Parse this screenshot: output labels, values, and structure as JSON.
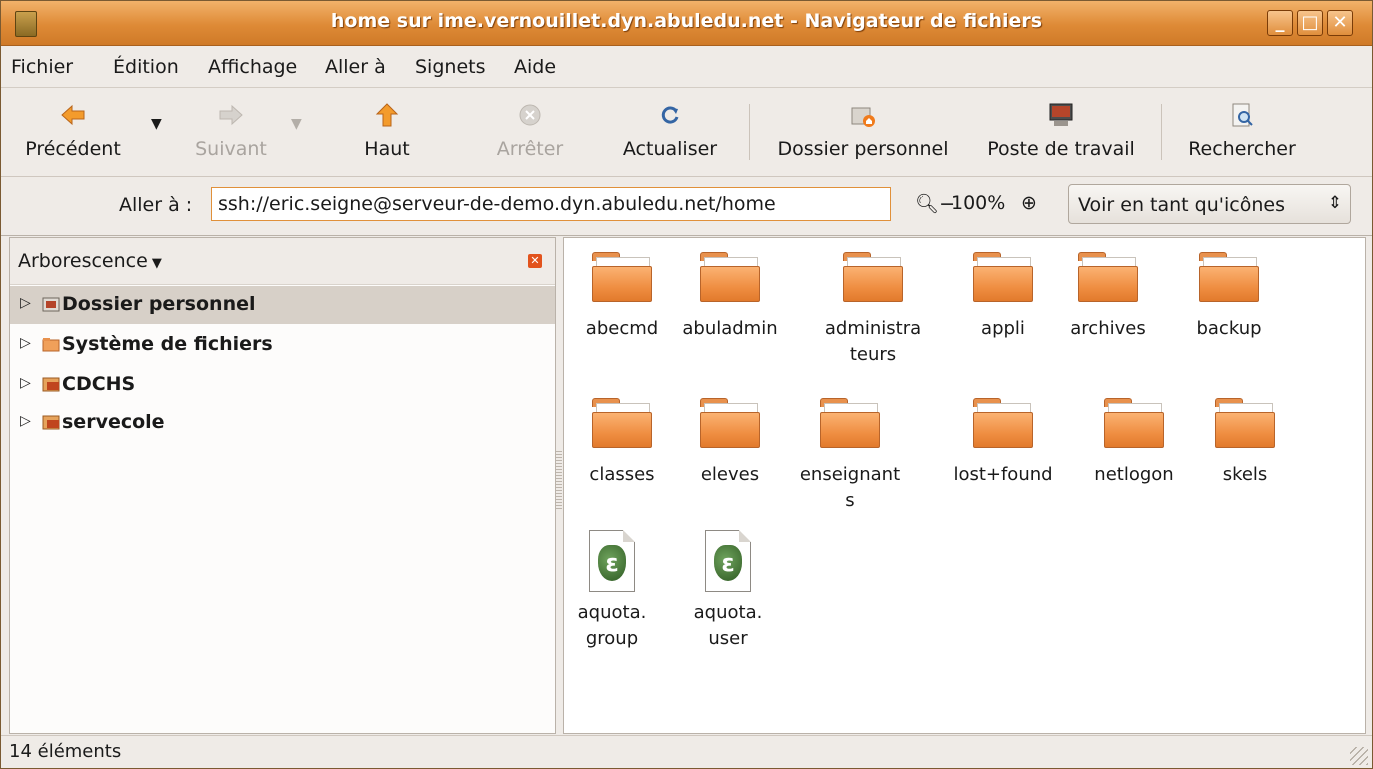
{
  "window": {
    "title": "home sur ime.vernouillet.dyn.abuledu.net - Navigateur de fichiers"
  },
  "menubar": {
    "items": [
      "Fichier",
      "Édition",
      "Affichage",
      "Aller à",
      "Signets",
      "Aide"
    ]
  },
  "toolbar": {
    "back": "Précédent",
    "forward": "Suivant",
    "up": "Haut",
    "stop": "Arrêter",
    "reload": "Actualiser",
    "home": "Dossier personnel",
    "computer": "Poste de travail",
    "search": "Rechercher"
  },
  "location": {
    "label": "Aller à :",
    "value": "ssh://eric.seigne@serveur-de-demo.dyn.abuledu.net/home",
    "zoom": "100%",
    "view_mode": "Voir en tant qu'icônes"
  },
  "sidepane": {
    "title": "Arborescence",
    "items": [
      "Dossier personnel",
      "Système de fichiers",
      "CDCHS",
      "servecole"
    ]
  },
  "files": [
    {
      "name": "abecmd",
      "type": "folder"
    },
    {
      "name": "abuladmin",
      "type": "folder"
    },
    {
      "name": "administra\nteurs",
      "type": "folder"
    },
    {
      "name": "appli",
      "type": "folder"
    },
    {
      "name": "archives",
      "type": "folder"
    },
    {
      "name": "backup",
      "type": "folder"
    },
    {
      "name": "classes",
      "type": "folder"
    },
    {
      "name": "eleves",
      "type": "folder"
    },
    {
      "name": "enseignant\ns",
      "type": "folder"
    },
    {
      "name": "lost+found",
      "type": "folder"
    },
    {
      "name": "netlogon",
      "type": "folder"
    },
    {
      "name": "skels",
      "type": "folder"
    },
    {
      "name": "aquota.\ngroup",
      "type": "file"
    },
    {
      "name": "aquota.\nuser",
      "type": "file"
    }
  ],
  "status": {
    "text": "14 éléments"
  },
  "colors": {
    "accent": "#de8a36",
    "folder": "#ef8e42"
  }
}
